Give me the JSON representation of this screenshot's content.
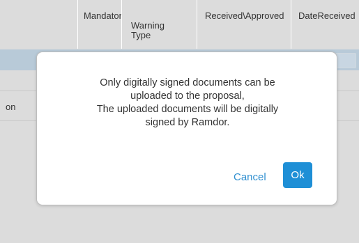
{
  "table": {
    "columns": [
      "Mandatory",
      "Warning\nType",
      "Received\\Approved",
      "DateReceived"
    ],
    "row_cell_fragment": "on"
  },
  "dialog": {
    "lines": [
      "Only digitally signed documents can be",
      "uploaded to the proposal,",
      "The uploaded documents will be digitally",
      "signed by Ramdor."
    ],
    "cancel_label": "Cancel",
    "ok_label": "Ok"
  },
  "colors": {
    "backdrop": "#dcdcdc",
    "filter_row": "#b8cad8",
    "accent": "#1e8fd6"
  }
}
